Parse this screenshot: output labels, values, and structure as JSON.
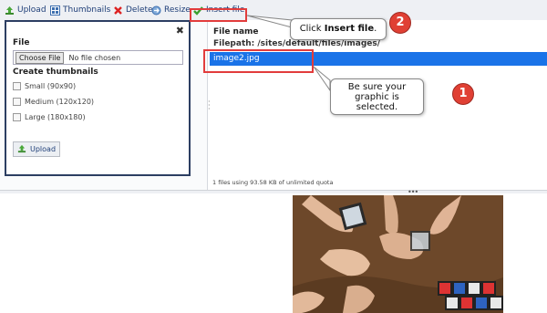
{
  "toolbar": {
    "upload": "Upload",
    "thumbnails": "Thumbnails",
    "delete": "Delete",
    "resize": "Resize",
    "insert_file": "Insert file"
  },
  "upload_panel": {
    "file_label": "File",
    "choose_file": "Choose File",
    "no_file": "No file chosen",
    "create_thumbnails": "Create thumbnails",
    "options": [
      "Small (90x90)",
      "Medium (120x120)",
      "Large (180x180)"
    ],
    "upload_button": "Upload"
  },
  "file_list": {
    "column_header": "File name",
    "filepath": "Filepath: /sites/default/files/images/",
    "selected_file": "image2.jpg",
    "status": "1 files using 93.58 KB of unlimited quota"
  },
  "callouts": {
    "insert_pre": "Click ",
    "insert_bold": "Insert file",
    "insert_post": ".",
    "select_text": "Be sure your graphic is selected.",
    "badge1": "1",
    "badge2": "2"
  },
  "colors": {
    "selection": "#1a73e8",
    "callout_border": "#e23c3c",
    "badge": "#e04034"
  },
  "icons": [
    "upload-icon",
    "thumbnails-icon",
    "delete-icon",
    "resize-icon",
    "checkmark-icon",
    "close-icon"
  ]
}
